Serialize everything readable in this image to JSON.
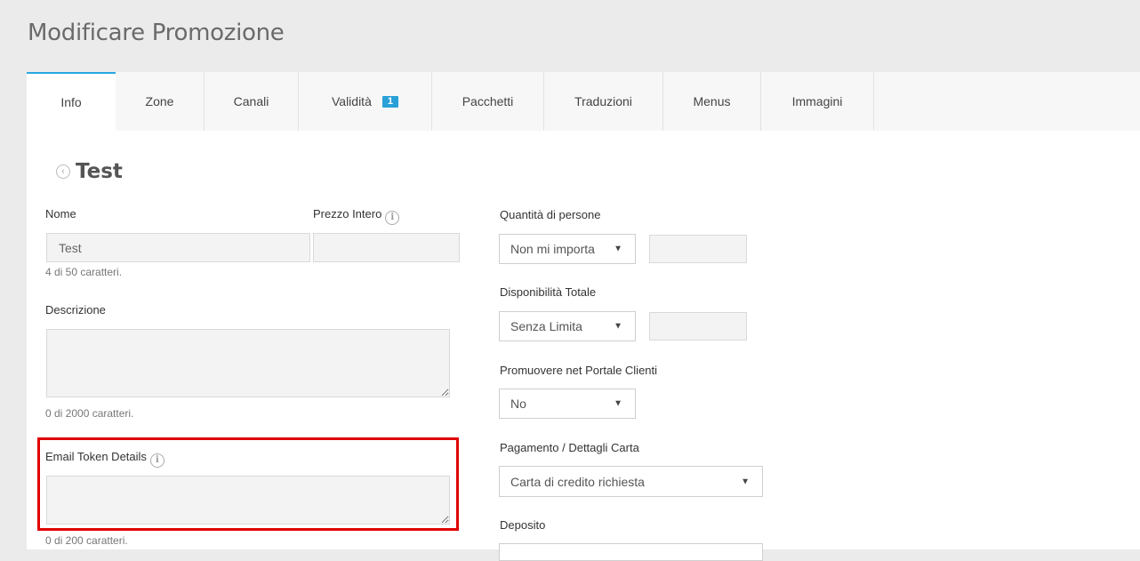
{
  "header": {
    "title": "Modificare Promozione"
  },
  "tabs": [
    {
      "label": "Info"
    },
    {
      "label": "Zone"
    },
    {
      "label": "Canali"
    },
    {
      "label": "Validità",
      "badge": "1"
    },
    {
      "label": "Pacchetti"
    },
    {
      "label": "Traduzioni"
    },
    {
      "label": "Menus"
    },
    {
      "label": "Immagini"
    }
  ],
  "accent_color": "#29a8e0",
  "highlight_color": "#e00000",
  "form": {
    "heading": "Test",
    "nome": {
      "label": "Nome",
      "value": "Test",
      "counter": "4 di 50 caratteri."
    },
    "prezzo_intero": {
      "label": "Prezzo Intero",
      "value": ""
    },
    "descrizione": {
      "label": "Descrizione",
      "value": "",
      "counter": "0 di 2000 caratteri."
    },
    "email_token": {
      "label": "Email Token Details",
      "value": "",
      "counter": "0 di 200 caratteri."
    },
    "quantita": {
      "label": "Quantità di persone",
      "selected": "Non mi importa",
      "value": ""
    },
    "disponibilita": {
      "label": "Disponibilità Totale",
      "selected": "Senza Limita",
      "value": ""
    },
    "portale": {
      "label": "Promuovere net Portale Clienti",
      "selected": "No"
    },
    "pagamento": {
      "label": "Pagamento / Dettagli Carta",
      "selected": "Carta di credito richiesta"
    },
    "deposito": {
      "label": "Deposito"
    }
  }
}
